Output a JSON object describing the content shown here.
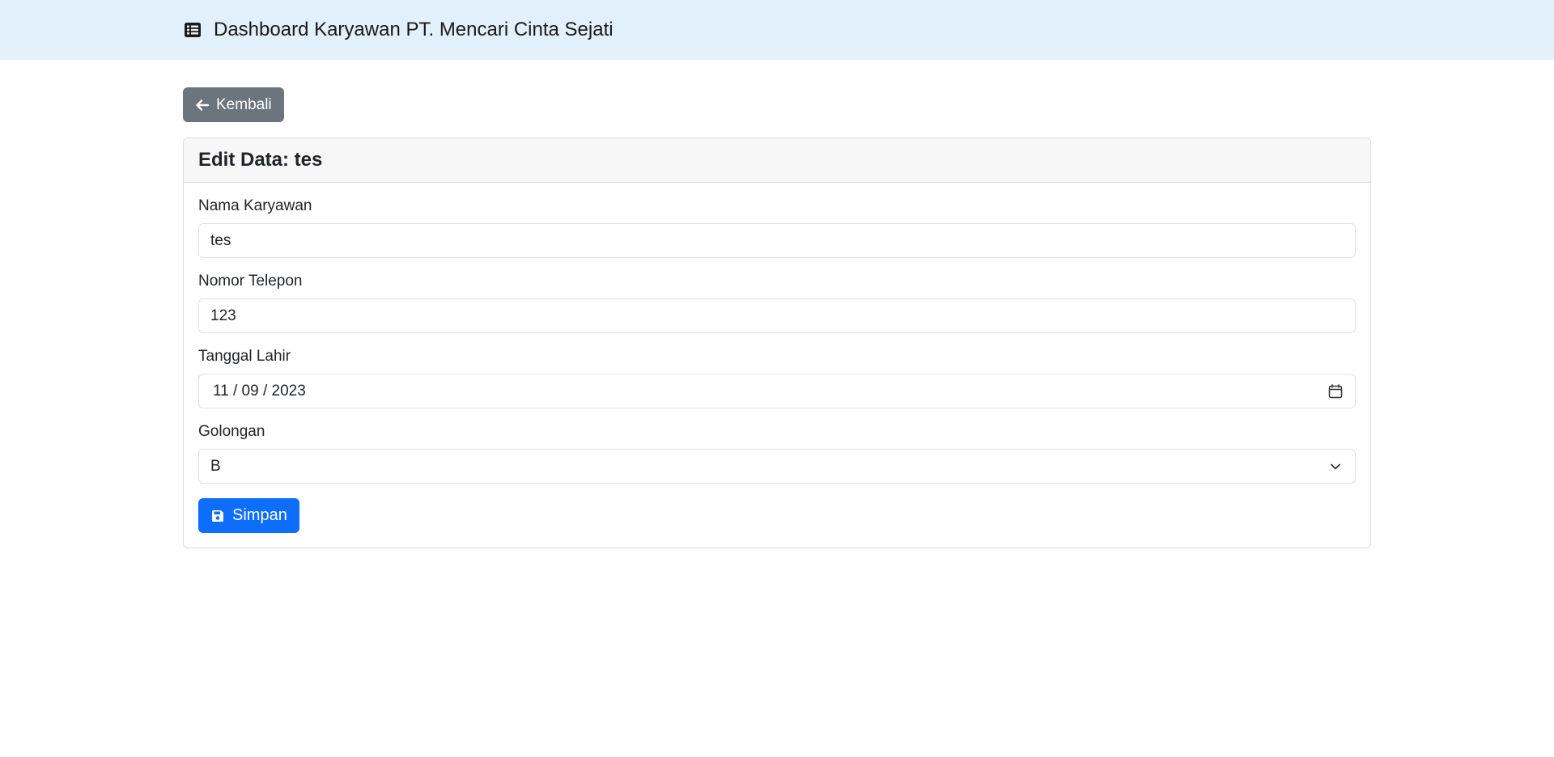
{
  "navbar": {
    "brand_icon": "table-list-icon",
    "brand_text": "Dashboard Karyawan PT. Mencari Cinta Sejati"
  },
  "back_button": {
    "icon": "arrow-left-icon",
    "label": "Kembali"
  },
  "card": {
    "title": "Edit Data: tes",
    "fields": {
      "nama": {
        "label": "Nama Karyawan",
        "value": "tes"
      },
      "telepon": {
        "label": "Nomor Telepon",
        "value": "123"
      },
      "tanggal": {
        "label": "Tanggal Lahir",
        "value": "11 / 09 / 2023",
        "icon": "calendar-icon"
      },
      "golongan": {
        "label": "Golongan",
        "value": "B",
        "icon": "chevron-down-icon"
      }
    },
    "save_button": {
      "icon": "floppy-disk-icon",
      "label": "Simpan"
    }
  },
  "colors": {
    "navbar_bg": "#e2f0fc",
    "back_button_bg": "#6c757d",
    "save_button_bg": "#0d6efd"
  }
}
